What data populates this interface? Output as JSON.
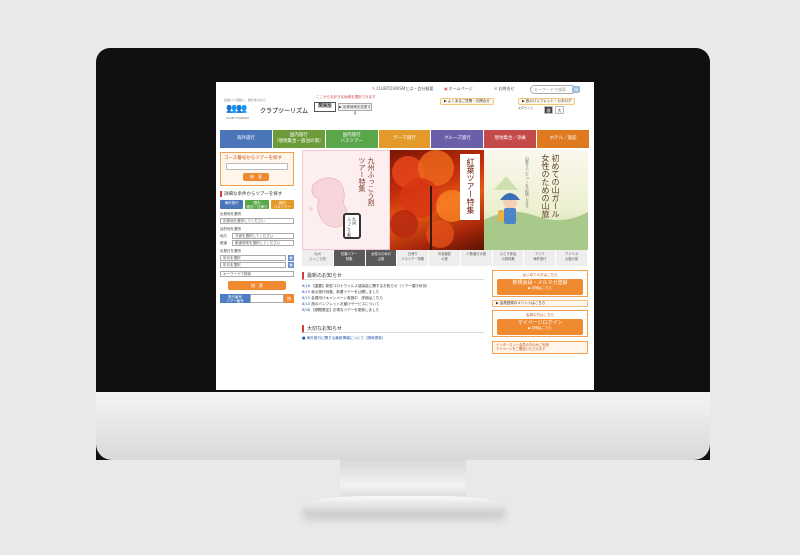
{
  "utility": {
    "sitemap": "CLUBTOURISMとは・会社概要",
    "mypage": "ホームページ",
    "inquiry": "お問合せ",
    "search_placeholder": "キーワードで検索",
    "search_button": "検"
  },
  "header": {
    "logo_tag": "出会いと感動と、旅があるから",
    "logo_text": "クラブツーリズム",
    "logo_sub": "CLUB TOURISM",
    "catch": "ここからお好きな地域を選択できます",
    "region": "関東版",
    "region_change": "▶ 出発地域を変更する",
    "link_faq": "▶ よくあるご質問・お問合せ",
    "link_brochure": "▶ 旅のパンフレット・カタログ",
    "font_size_label": "文字サイズ",
    "font_std": "標準",
    "font_large": "大"
  },
  "nav": [
    {
      "label": "海外旅行",
      "color": "#4a76b9"
    },
    {
      "label": "国内旅行\n（現地集合・宿泊の旅）",
      "color": "#6c9c3a"
    },
    {
      "label": "国内旅行\nバスツアー",
      "color": "#5aa64a"
    },
    {
      "label": "テーマ旅行",
      "color": "#e39a2a"
    },
    {
      "label": "クルーズ旅行",
      "color": "#6a5fa8"
    },
    {
      "label": "現地集合／添乗",
      "color": "#c44a4a"
    },
    {
      "label": "ホテル／旅館",
      "color": "#e07a20"
    }
  ],
  "left": {
    "keyword_title": "コース番号からツアーを探す",
    "keyword_button": "検　索",
    "search_title": "詳細な条件からツアーを探す",
    "tabs": [
      {
        "label": "海外旅行",
        "color": "#4a76b9"
      },
      {
        "label": "国内\n宿泊・日帰り",
        "color": "#5aa64a"
      },
      {
        "label": "国内\nバスツアー",
        "color": "#e39a2a"
      }
    ],
    "area_label": "出発地を選択",
    "area_value": "出発地を選択してください",
    "dest_label": "目的地を選択",
    "dest_region": "地方",
    "dest_region_value": "方面を選択してください",
    "dest_pref": "都道",
    "dest_pref_value": "都道府県を選択してください",
    "date_label": "出発日を選択",
    "date_from": "年月を選択",
    "date_to": "年月を選択",
    "keyword_value": "キーワードで検索",
    "search_button": "検　索",
    "tour_no_label": "旅行番号\nツアー番号",
    "tour_no_button": "検"
  },
  "banners": {
    "b1_title": "九州ふっこう割\nツアー特集",
    "b1_badge": "九州\nふっこう割",
    "b2_title": "紅葉ツアー特集",
    "b3_title": "初めての山ガール\n女性のための山旅",
    "b3_sub": "山登りデビューを応援します"
  },
  "thumbs": [
    {
      "label": "九州\nふっこう割",
      "dark": false
    },
    {
      "label": "紅葉ツアー\n特集",
      "dark": true
    },
    {
      "label": "女性のための\n山旅",
      "dark": true
    },
    {
      "label": "日帰り\nバスツアー特集",
      "dark": false
    },
    {
      "label": "写真撮影\nの旅",
      "dark": false
    },
    {
      "label": "少数催行の旅",
      "dark": false
    },
    {
      "label": "ひとり参加\nの旅特集",
      "dark": false
    },
    {
      "label": "アジア\n海外旅行",
      "dark": false
    },
    {
      "label": "アメリカ\n大陸の旅",
      "dark": false
    }
  ],
  "news": {
    "title": "最新のお知らせ",
    "items": [
      {
        "date": "8/18",
        "text": "【重要】新型コロナウイルス感染症に関するお知らせ（ツアー運行状況）"
      },
      {
        "date": "8/15",
        "text": "秋の旅行特集、新着ツアーを公開しました"
      },
      {
        "date": "8/12",
        "text": "会員向けキャンペーン実施中　詳細はこちら"
      },
      {
        "date": "8/10",
        "text": "旅のパンフレットお届けサービスについて"
      },
      {
        "date": "8/08",
        "text": "【期間限定】お得なツアーを更新しました"
      }
    ],
    "important_title": "大切なお知らせ",
    "important_items": [
      "■ 海外旅行に関する最新情報について（随時更新）"
    ]
  },
  "member": {
    "new_small": "はじめての方はこちら",
    "new_button": "新規会員・メルマガ登録",
    "new_sub": "▶ 詳細はこちら",
    "merit": "▶ 会員登録のメリットはこちら",
    "login_small": "会員の方はこちら",
    "login_button": "マイページログイン",
    "login_sub": "▶ 詳細はこちら",
    "note": "インターネット会員の方のみご利用\nマイページをご確認いただけます"
  }
}
